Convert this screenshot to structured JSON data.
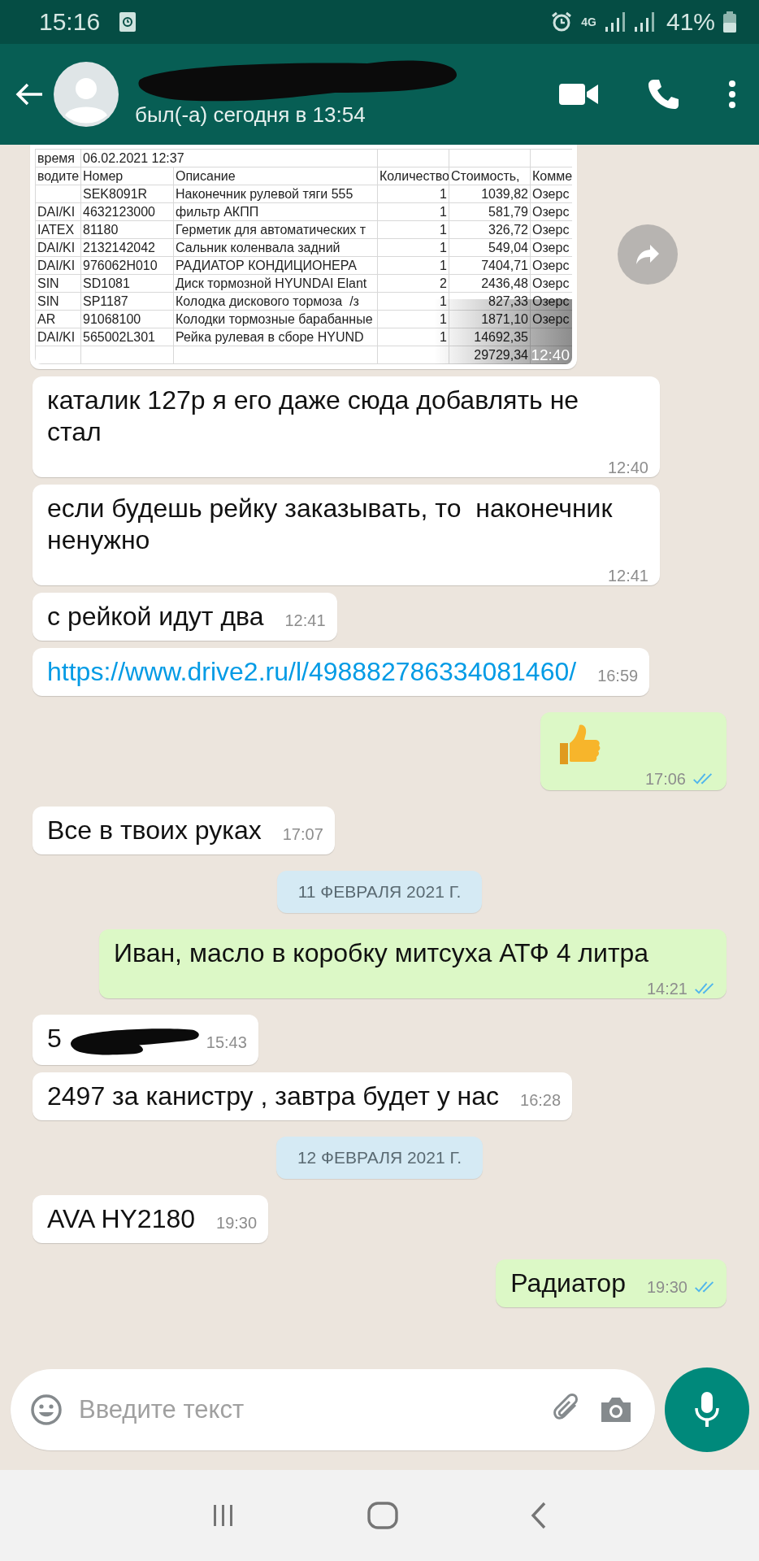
{
  "status_bar": {
    "time": "15:16",
    "network": "4G",
    "battery": "41%"
  },
  "header": {
    "status": "был(-а) сегодня в 13:54",
    "name_hidden": true
  },
  "messages": [
    {
      "kind": "image",
      "outgoing": false,
      "time": "12:40",
      "sheet": {
        "date_row": {
          "label": "время",
          "value": "06.02.2021 12:37"
        },
        "columns": [
          "водите",
          "Номер",
          "Описание",
          "Количество",
          "Стоимость,",
          "Комме"
        ],
        "rows": [
          {
            "number": "SEK8091R",
            "description": "Наконечник рулевой тяги 555",
            "quantity": "1",
            "cost": "1039,82",
            "comment": "Озерс"
          },
          {
            "column_1": "DAI/KI",
            "number": "4632123000",
            "description": "фильтр АКПП",
            "quantity": "1",
            "cost": "581,79",
            "comment": "Озерс"
          },
          {
            "column_1": "IATEX",
            "number": "81180",
            "description": "Герметик для автоматических т",
            "quantity": "1",
            "cost": "326,72",
            "comment": "Озерс"
          },
          {
            "column_1": "DAI/KI",
            "number": "2132142042",
            "description": "Сальник коленвала задний",
            "quantity": "1",
            "cost": "549,04",
            "comment": "Озерс"
          },
          {
            "column_1": "DAI/KI",
            "number": "976062H010",
            "description": "РАДИАТОР КОНДИЦИОНЕРА",
            "quantity": "1",
            "cost": "7404,71",
            "comment": "Озерс"
          },
          {
            "column_1": "SIN",
            "number": "SD1081",
            "description": "Диск тормозной HYUNDAI Elant",
            "quantity": "2",
            "cost": "2436,48",
            "comment": "Озерс"
          },
          {
            "column_1": "SIN",
            "number": "SP1187",
            "description": "Колодка дискового тормоза  /з",
            "quantity": "1",
            "cost": "827,33",
            "comment": "Озерс"
          },
          {
            "column_1": "AR",
            "number": "91068100",
            "description": "Колодки тормозные барабанные",
            "quantity": "1",
            "cost": "1871,10",
            "comment": "Озерс"
          },
          {
            "column_1": "DAI/KI",
            "number": "565002L301",
            "description": "Рейка рулевая в сборе HYUND",
            "quantity": "1",
            "cost": "14692,35"
          }
        ],
        "total": "29729,34"
      }
    },
    {
      "kind": "text",
      "outgoing": false,
      "text": "каталик 127р я его даже сюда добавлять не стал",
      "time": "12:40"
    },
    {
      "kind": "text",
      "outgoing": false,
      "text": "если будешь рейку заказывать, то  наконечник ненужно",
      "time": "12:41"
    },
    {
      "kind": "text",
      "outgoing": false,
      "text": "с рейкой идут два",
      "time": "12:41"
    },
    {
      "kind": "link",
      "outgoing": false,
      "text": "https://www.drive2.ru/l/498882786334081460/",
      "time": "16:59"
    },
    {
      "kind": "emoji",
      "outgoing": true,
      "time": "17:06",
      "read": true
    },
    {
      "kind": "text",
      "outgoing": false,
      "text": "Все в твоих руках",
      "time": "17:07"
    },
    {
      "kind": "date",
      "text": "11 ФЕВРАЛЯ 2021 Г."
    },
    {
      "kind": "text",
      "outgoing": true,
      "text": "Иван, масло в коробку митсуха АТФ 4 литра",
      "time": "14:21",
      "read": true
    },
    {
      "kind": "redacted",
      "outgoing": false,
      "text": "5",
      "time": "15:43"
    },
    {
      "kind": "text",
      "outgoing": false,
      "text": "2497 за канистру , завтра будет у нас",
      "time": "16:28"
    },
    {
      "kind": "date",
      "text": "12 ФЕВРАЛЯ 2021 Г."
    },
    {
      "kind": "text",
      "outgoing": false,
      "text": "AVA HY2180",
      "time": "19:30"
    },
    {
      "kind": "text",
      "outgoing": true,
      "text": "Радиатор",
      "time": "19:30",
      "read": true
    }
  ],
  "composer": {
    "placeholder": "Введите текст"
  }
}
